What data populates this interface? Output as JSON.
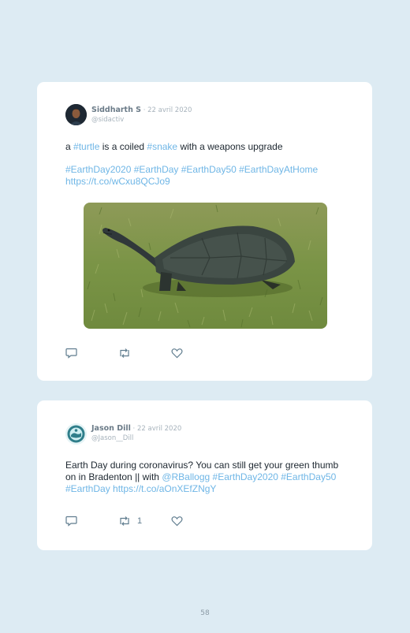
{
  "tweets": [
    {
      "author": "Siddharth S",
      "date": "22 avril 2020",
      "handle": "@sidactiv",
      "line1": [
        {
          "text": "a ",
          "link": false
        },
        {
          "text": "#turtle",
          "link": true
        },
        {
          "text": " is a coiled ",
          "link": false
        },
        {
          "text": "#snake",
          "link": true
        },
        {
          "text": " with a weapons upgrade",
          "link": false
        }
      ],
      "line2": [
        {
          "text": "#EarthDay2020 #EarthDay #EarthDay50 #EarthDayAtHome https://t.co/wCxu8QCJo9",
          "link": true
        }
      ],
      "media": "turtle-photo",
      "retweets": ""
    },
    {
      "author": "Jason Dill",
      "date": "22 avril 2020",
      "handle": "@Jason__Dill",
      "line1": [
        {
          "text": "Earth Day during coronavirus? You can still get your green thumb on in Bradenton || with ",
          "link": false
        },
        {
          "text": "@RBallogg #EarthDay2020 #EarthDay50 #EarthDay https://t.co/aOnXEfZNgY",
          "link": true
        }
      ],
      "retweets": "1"
    }
  ],
  "page_number": "58",
  "colors": {
    "background": "#ddebf3",
    "card": "#ffffff",
    "link": "#6fb6e6",
    "icon": "#5f7c8e"
  },
  "icons": [
    "reply-icon",
    "retweet-icon",
    "like-icon"
  ]
}
